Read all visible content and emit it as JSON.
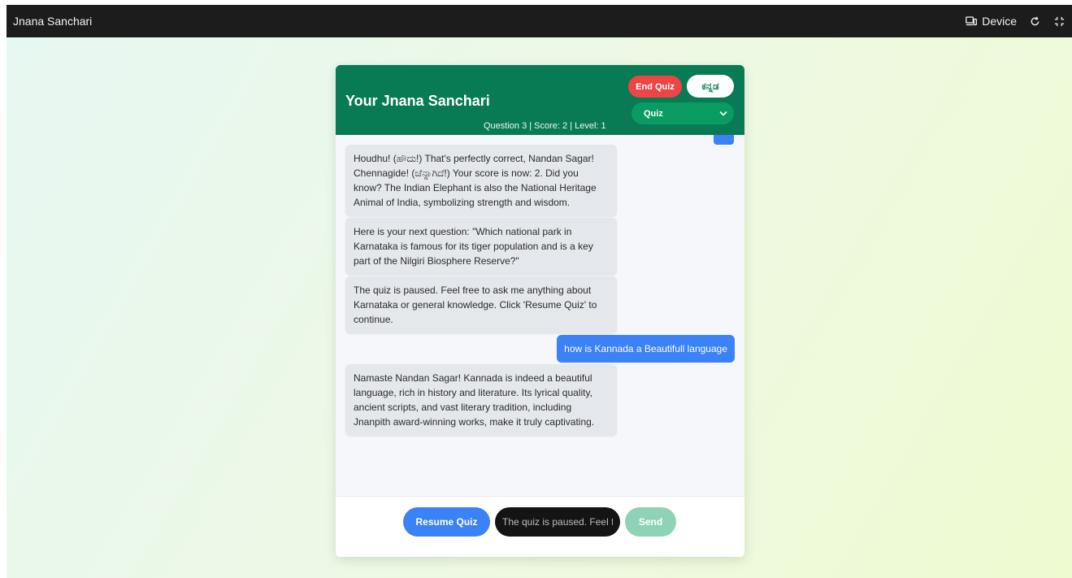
{
  "window": {
    "title": "Jnana Sanchari",
    "device_label": "Device",
    "refresh_icon": "refresh-icon",
    "fullscreen_icon": "fullscreen-icon"
  },
  "header": {
    "title": "Your Jnana Sanchari",
    "end_quiz_label": "End Quiz",
    "language_label": "ಕನ್ನಡ",
    "mode_select_value": "Quiz",
    "stats": "Question 3 | Score: 2 | Level: 1"
  },
  "messages": {
    "bot_1": "Houdhu! (ಹೌದು!) That's perfectly correct, Nandan Sagar! Chennagide! (ಚೆನ್ನಾಗಿದೆ!) Your score is now: 2. Did you know? The Indian Elephant is also the National Heritage Animal of India, symbolizing strength and wisdom.",
    "bot_2": "Here is your next question: \"Which national park in Karnataka is famous for its tiger population and is a key part of the Nilgiri Biosphere Reserve?\"",
    "bot_3": "The quiz is paused. Feel free to ask me anything about Karnataka or general knowledge. Click 'Resume Quiz' to continue.",
    "user_1": "how is Kannada a Beautifull language",
    "bot_4": "Namaste Nandan Sagar! Kannada is indeed a beautiful language, rich in history and literature. Its lyrical quality, ancient scripts, and vast literary tradition, including Jnanpith award-winning works, make it truly captivating."
  },
  "footer": {
    "resume_label": "Resume Quiz",
    "input_placeholder": "The quiz is paused. Feel free to ask me anything",
    "send_label": "Send"
  },
  "colors": {
    "header_green": "#087b55",
    "end_quiz_red": "#ef4444",
    "user_blue": "#3b82f6",
    "send_disabled": "#8fd3b6"
  }
}
